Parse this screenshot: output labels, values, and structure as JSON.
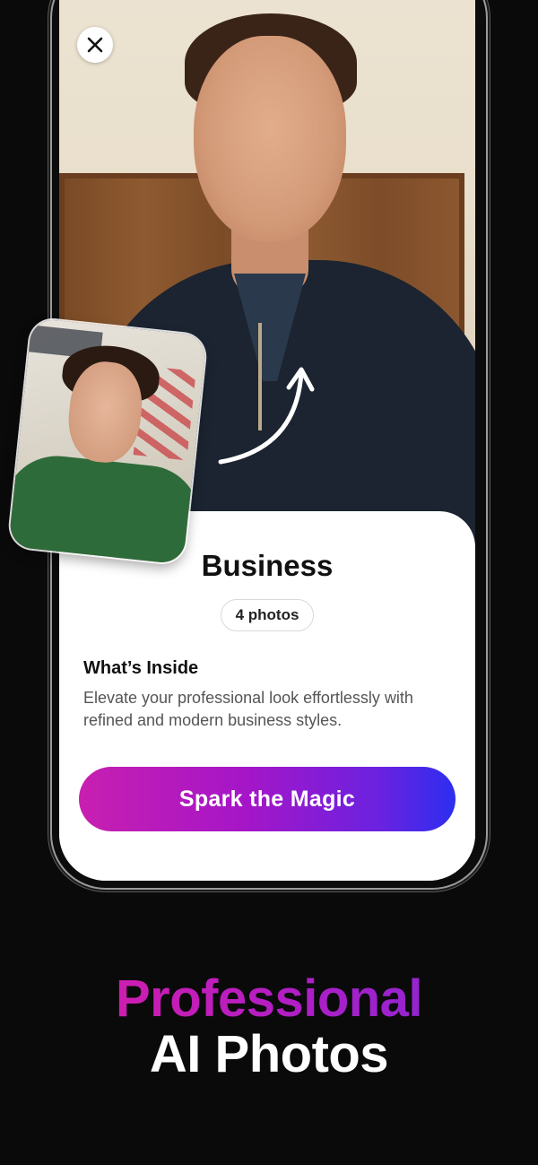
{
  "colors": {
    "background": "#0a0a0a",
    "card": "#ffffff",
    "cta_gradient_start": "#c81fb0",
    "cta_gradient_end": "#2d2ef0",
    "headline_gradient_start": "#e21ca2",
    "headline_gradient_end": "#7a2ad8"
  },
  "icons": {
    "close": "close-icon",
    "arrow": "curved-arrow-up-icon"
  },
  "card": {
    "title": "Business",
    "badge": "4 photos",
    "section_title": "What’s Inside",
    "section_desc": "Elevate your professional look effortlessly with refined and modern business styles.",
    "cta_label": "Spark the Magic"
  },
  "promo": {
    "line1": "Professional",
    "line2": "AI Photos"
  }
}
